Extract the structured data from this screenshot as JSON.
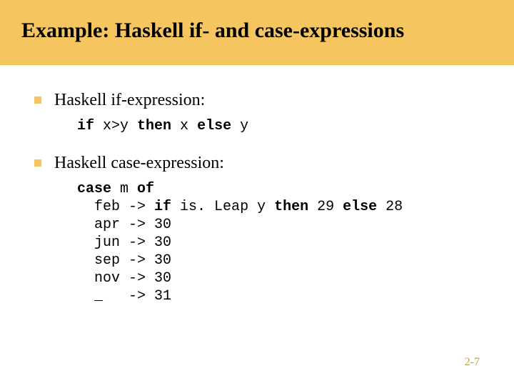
{
  "title": "Example: Haskell if- and case-expressions",
  "bullets": [
    {
      "text": "Haskell if-expression:"
    },
    {
      "text": "Haskell case-expression:"
    }
  ],
  "code1": {
    "kw_if": "if",
    "seg1": " x>y ",
    "kw_then": "then",
    "seg2": " x ",
    "kw_else": "else",
    "seg3": " y"
  },
  "code2": {
    "l1_kw_case": "case",
    "l1_rest": " m ",
    "l1_kw_of": "of",
    "l2_a": "  feb -> ",
    "l2_kw_if": "if",
    "l2_b": " is. Leap y ",
    "l2_kw_then": "then",
    "l2_c": " 29 ",
    "l2_kw_else": "else",
    "l2_d": " 28",
    "l3": "  apr -> 30",
    "l4": "  jun -> 30",
    "l5": "  sep -> 30",
    "l6": "  nov -> 30",
    "l7": "  _   -> 31"
  },
  "page_number": "2-7"
}
